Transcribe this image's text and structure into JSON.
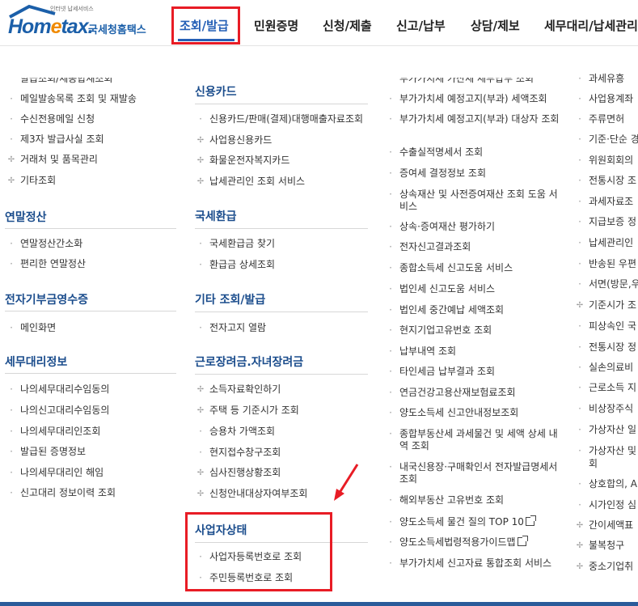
{
  "header": {
    "slogan": "인터넷 납세서비스",
    "brand_home": "Hom",
    "brand_e": "e",
    "brand_tax": "tax.",
    "brand_ko": "국세청홈택스",
    "nav": [
      "조회/발급",
      "민원증명",
      "신청/제출",
      "신고/납부",
      "상담/제보",
      "세무대리/납세관리"
    ]
  },
  "col1": {
    "items_top": [
      {
        "label": "발급조회/세종합재조회",
        "b": "dot"
      },
      {
        "label": "메일발송목록 조회 및 재발송",
        "b": "dot"
      },
      {
        "label": "수신전용메일 신청",
        "b": "dot"
      },
      {
        "label": "제3자 발급사실 조회",
        "b": "dot"
      },
      {
        "label": "거래처 및 품목관리",
        "b": "plus"
      },
      {
        "label": "기타조회",
        "b": "plus"
      }
    ],
    "sec_yearend": {
      "title": "연말정산",
      "items": [
        "연말정산간소화",
        "편리한 연말정산"
      ]
    },
    "sec_donation": {
      "title": "전자기부금영수증",
      "items": [
        "메인화면"
      ]
    },
    "sec_agent": {
      "title": "세무대리정보",
      "items": [
        "나의세무대리수임동의",
        "나의신고대리수임동의",
        "나의세무대리인조회",
        "발급된 증명정보",
        "나의세무대리인 해임",
        "신고대리 정보이력 조회"
      ]
    }
  },
  "col2": {
    "sec_card": {
      "title": "신용카드",
      "items": [
        {
          "label": "신용카드/판매(결제)대행매출자료조회",
          "b": "dot"
        },
        {
          "label": "사업용신용카드",
          "b": "plus"
        },
        {
          "label": "화물운전자복지카드",
          "b": "plus"
        },
        {
          "label": "납세관리인 조회 서비스",
          "b": "plus"
        }
      ]
    },
    "sec_refund": {
      "title": "국세환급",
      "items": [
        "국세환급금 찾기",
        "환급금 상세조회"
      ]
    },
    "sec_etc": {
      "title": "기타 조회/발급",
      "items": [
        "전자고지 열람"
      ]
    },
    "sec_earned": {
      "title": "근로장려금.자녀장려금",
      "items": [
        {
          "label": "소득자료확인하기",
          "b": "plus"
        },
        {
          "label": "주택 등 기준시가 조회",
          "b": "plus"
        },
        {
          "label": "승용차 가액조회",
          "b": "dot"
        },
        {
          "label": "현지접수창구조회",
          "b": "dot"
        },
        {
          "label": "심사진행상황조회",
          "b": "plus"
        },
        {
          "label": "신청안내대상자여부조회",
          "b": "plus"
        }
      ]
    },
    "sec_biz": {
      "title": "사업자상태",
      "items": [
        "사업자등록번호로 조회",
        "주민등록번호로 조회"
      ]
    }
  },
  "col3": {
    "items": [
      "부가가치세 예정고지(부과) 세액조회",
      "부가가치세 예정고지(부과) 대상자 조회",
      "수출실적명세서 조회",
      "증여세 결정정보 조회",
      "상속재산 및 사전증여재산 조회 도움 서비스",
      "상속·증여재산 평가하기",
      "전자신고결과조회",
      "종합소득세 신고도움 서비스",
      "법인세 신고도움 서비스",
      "법인세 중간예납 세액조회",
      "현지기업고유번호 조회",
      "납부내역 조회",
      "타인세금 납부결과 조회",
      "연금건강고용산재보험료조회",
      "양도소득세 신고안내정보조회",
      "종합부동산세 과세물건 및 세액 상세 내역 조회",
      "내국신용장·구매확인서 전자발급명세서 조회",
      "해외부동산 고유번호 조회",
      "양도소득세 물건 질의 TOP 10",
      "양도소득세법령적용가이드맵",
      "부가가치세 신고자료 통합조회 서비스"
    ]
  },
  "col4": {
    "items": [
      {
        "label": "과세유흥",
        "b": "dot"
      },
      {
        "label": "사업용계좌",
        "b": "dot"
      },
      {
        "label": "주류면허",
        "b": "dot"
      },
      {
        "label": "기준·단순 경",
        "b": "dot"
      },
      {
        "label": "위원회회의",
        "b": "dot"
      },
      {
        "label": "전통시장 조",
        "b": "dot"
      },
      {
        "label": "과세자료조",
        "b": "dot"
      },
      {
        "label": "지급보증 정",
        "b": "dot"
      },
      {
        "label": "납세관리인",
        "b": "dot"
      },
      {
        "label": "반송된 우편",
        "b": "dot"
      },
      {
        "label": "서면(방문,우",
        "b": "dot"
      },
      {
        "label": "기준시가 조",
        "b": "plus"
      },
      {
        "label": "피상속인 국",
        "b": "dot"
      },
      {
        "label": "전통시장 정",
        "b": "dot"
      },
      {
        "label": "실손의료비",
        "b": "dot"
      },
      {
        "label": "근로소득 지",
        "b": "dot"
      },
      {
        "label": "비상장주식",
        "b": "dot"
      },
      {
        "label": "가상자산 일",
        "b": "dot"
      },
      {
        "label": "가상자산 및",
        "b": "dot"
      },
      {
        "label": "회",
        "b": "none"
      },
      {
        "label": "상호합의, AP",
        "b": "dot"
      },
      {
        "label": "시가인정 심",
        "b": "dot"
      },
      {
        "label": "간이세액표",
        "b": "plus"
      },
      {
        "label": "불복청구",
        "b": "plus"
      },
      {
        "label": "중소기업취",
        "b": "plus"
      }
    ]
  },
  "colors": {
    "accent": "#2560b6",
    "highlight": "#e81c25",
    "section_title": "#1a4c8c"
  }
}
